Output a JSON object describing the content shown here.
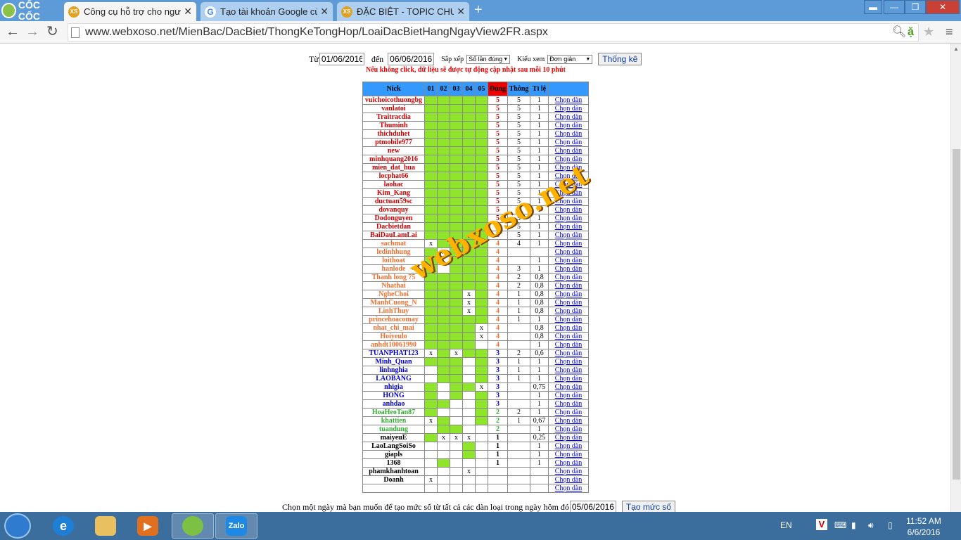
{
  "browser": {
    "brand": "CỐC CỐC",
    "tabs": [
      {
        "label": "Công cụ hỗ trợ cho người",
        "active": true
      },
      {
        "label": "Tạo tài khoản Google của",
        "active": false
      },
      {
        "label": "ĐẶC BIỆT - TOPIC CHUYÊN",
        "active": false
      }
    ],
    "url": "www.webxoso.net/MienBac/DacBiet/ThongKeTongHop/LoaiDacBietHangNgayView2FR.aspx"
  },
  "filter": {
    "from_label": "Từ",
    "from_value": "01/06/2016",
    "to_label": "đến",
    "to_value": "06/06/2016",
    "sort_label": "Sắp xếp",
    "sort_value": "Số lần đúng",
    "view_label": "Kiểu xem",
    "view_value": "Đơn giản",
    "submit_label": "Thống kê"
  },
  "note": "Nếu không click, dữ liệu sẽ được tự động cập nhật sau mỗi 10 phút",
  "table": {
    "headers": [
      "Nick",
      "01",
      "02",
      "03",
      "04",
      "05",
      "Đúng",
      "Thông",
      "Tỉ lệ",
      ""
    ],
    "link_label": "Chọn dàn",
    "rows": [
      {
        "nick": "vuichoicothuongbg",
        "c": [
          "g",
          "g",
          "g",
          "g",
          "g"
        ],
        "dung": "5",
        "thong": "5",
        "tile": "1",
        "color": "#d00000"
      },
      {
        "nick": "vanlatoi",
        "c": [
          "g",
          "g",
          "g",
          "g",
          "g"
        ],
        "dung": "5",
        "thong": "5",
        "tile": "1",
        "color": "#d00000"
      },
      {
        "nick": "Traitracdia",
        "c": [
          "g",
          "g",
          "g",
          "g",
          "g"
        ],
        "dung": "5",
        "thong": "5",
        "tile": "1",
        "color": "#d00000"
      },
      {
        "nick": "Thuminh",
        "c": [
          "g",
          "g",
          "g",
          "g",
          "g"
        ],
        "dung": "5",
        "thong": "5",
        "tile": "1",
        "color": "#d00000"
      },
      {
        "nick": "thichduhet",
        "c": [
          "g",
          "g",
          "g",
          "g",
          "g"
        ],
        "dung": "5",
        "thong": "5",
        "tile": "1",
        "color": "#d00000"
      },
      {
        "nick": "ptmobile977",
        "c": [
          "g",
          "g",
          "g",
          "g",
          "g"
        ],
        "dung": "5",
        "thong": "5",
        "tile": "1",
        "color": "#d00000"
      },
      {
        "nick": "new",
        "c": [
          "g",
          "g",
          "g",
          "g",
          "g"
        ],
        "dung": "5",
        "thong": "5",
        "tile": "1",
        "color": "#d00000"
      },
      {
        "nick": "minhquang2016",
        "c": [
          "g",
          "g",
          "g",
          "g",
          "g"
        ],
        "dung": "5",
        "thong": "5",
        "tile": "1",
        "color": "#d00000"
      },
      {
        "nick": "mien_dat_hua",
        "c": [
          "g",
          "g",
          "g",
          "g",
          "g"
        ],
        "dung": "5",
        "thong": "5",
        "tile": "1",
        "color": "#d00000"
      },
      {
        "nick": "locphat66",
        "c": [
          "g",
          "g",
          "g",
          "g",
          "g"
        ],
        "dung": "5",
        "thong": "5",
        "tile": "1",
        "color": "#d00000"
      },
      {
        "nick": "laohac",
        "c": [
          "g",
          "g",
          "g",
          "g",
          "g"
        ],
        "dung": "5",
        "thong": "5",
        "tile": "1",
        "color": "#d00000"
      },
      {
        "nick": "Kim_Kang",
        "c": [
          "g",
          "g",
          "g",
          "g",
          "g"
        ],
        "dung": "5",
        "thong": "5",
        "tile": "1",
        "color": "#d00000"
      },
      {
        "nick": "ductuan59sc",
        "c": [
          "g",
          "g",
          "g",
          "g",
          "g"
        ],
        "dung": "5",
        "thong": "5",
        "tile": "1",
        "color": "#d00000"
      },
      {
        "nick": "dovanquy",
        "c": [
          "g",
          "g",
          "g",
          "g",
          "g"
        ],
        "dung": "5",
        "thong": "5",
        "tile": "1",
        "color": "#d00000"
      },
      {
        "nick": "Dodonguyen",
        "c": [
          "g",
          "g",
          "g",
          "g",
          "g"
        ],
        "dung": "5",
        "thong": "5",
        "tile": "1",
        "color": "#d00000"
      },
      {
        "nick": "Dacbietdan",
        "c": [
          "g",
          "g",
          "g",
          "g",
          "g"
        ],
        "dung": "5",
        "thong": "5",
        "tile": "1",
        "color": "#d00000"
      },
      {
        "nick": "BaiDauLamLai",
        "c": [
          "g",
          "g",
          "g",
          "g",
          "g"
        ],
        "dung": "5",
        "thong": "5",
        "tile": "1",
        "color": "#d00000"
      },
      {
        "nick": "sachmat",
        "c": [
          "x",
          "g",
          "g",
          "g",
          "g"
        ],
        "dung": "4",
        "thong": "4",
        "tile": "1",
        "color": "#f07030"
      },
      {
        "nick": "ledinhhung",
        "c": [
          "g",
          "x",
          "g",
          "g",
          "g"
        ],
        "dung": "4",
        "thong": "",
        "tile": "",
        "color": "#f07030"
      },
      {
        "nick": "loithoat",
        "c": [
          "g",
          "",
          "g",
          "g",
          "g"
        ],
        "dung": "4",
        "thong": "",
        "tile": "1",
        "color": "#f07030"
      },
      {
        "nick": "hanlode",
        "c": [
          "g",
          "",
          "g",
          "g",
          "g"
        ],
        "dung": "4",
        "thong": "3",
        "tile": "1",
        "color": "#f07030"
      },
      {
        "nick": "Thanh long 75",
        "c": [
          "g",
          "g",
          "g",
          "g",
          "g"
        ],
        "dung": "4",
        "thong": "2",
        "tile": "0,8",
        "color": "#f07030"
      },
      {
        "nick": "Nhathai",
        "c": [
          "g",
          "g",
          "g",
          "g",
          "g"
        ],
        "dung": "4",
        "thong": "2",
        "tile": "0,8",
        "color": "#f07030"
      },
      {
        "nick": "NgheChoi",
        "c": [
          "g",
          "g",
          "g",
          "x",
          "g"
        ],
        "dung": "4",
        "thong": "1",
        "tile": "0,8",
        "color": "#f07030"
      },
      {
        "nick": "ManhCuong_N",
        "c": [
          "g",
          "g",
          "g",
          "x",
          "g"
        ],
        "dung": "4",
        "thong": "1",
        "tile": "0,8",
        "color": "#f07030"
      },
      {
        "nick": "LinhThuy",
        "c": [
          "g",
          "g",
          "g",
          "x",
          "g"
        ],
        "dung": "4",
        "thong": "1",
        "tile": "0,8",
        "color": "#f07030"
      },
      {
        "nick": "princehoacomay",
        "c": [
          "g",
          "g",
          "g",
          "g",
          "g"
        ],
        "dung": "4",
        "thong": "1",
        "tile": "1",
        "color": "#f07030"
      },
      {
        "nick": "nhat_chi_mai",
        "c": [
          "g",
          "g",
          "g",
          "g",
          "x"
        ],
        "dung": "4",
        "thong": "",
        "tile": "0,8",
        "color": "#f07030"
      },
      {
        "nick": "Hoiyeulo",
        "c": [
          "g",
          "g",
          "g",
          "g",
          "x"
        ],
        "dung": "4",
        "thong": "",
        "tile": "0,8",
        "color": "#f07030"
      },
      {
        "nick": "anhdt10061990",
        "c": [
          "g",
          "g",
          "g",
          "g",
          ""
        ],
        "dung": "4",
        "thong": "",
        "tile": "1",
        "color": "#f07030"
      },
      {
        "nick": "TUANPHAT123",
        "c": [
          "x",
          "g",
          "x",
          "g",
          "g"
        ],
        "dung": "3",
        "thong": "2",
        "tile": "0,6",
        "color": "#0000dd"
      },
      {
        "nick": "Minh_Quan",
        "c": [
          "g",
          "g",
          "g",
          "",
          "g"
        ],
        "dung": "3",
        "thong": "1",
        "tile": "1",
        "color": "#0000dd"
      },
      {
        "nick": "linhnghia",
        "c": [
          "",
          "g",
          "g",
          "",
          "g"
        ],
        "dung": "3",
        "thong": "1",
        "tile": "1",
        "color": "#0000dd"
      },
      {
        "nick": "LAOBANG",
        "c": [
          "",
          "g",
          "g",
          "",
          "g"
        ],
        "dung": "3",
        "thong": "1",
        "tile": "1",
        "color": "#0000dd"
      },
      {
        "nick": "nhigia",
        "c": [
          "g",
          "",
          "g",
          "g",
          "x"
        ],
        "dung": "3",
        "thong": "",
        "tile": "0,75",
        "color": "#0000dd"
      },
      {
        "nick": "HONG",
        "c": [
          "g",
          "",
          "g",
          "",
          "g"
        ],
        "dung": "3",
        "thong": "",
        "tile": "1",
        "color": "#0000dd"
      },
      {
        "nick": "anhdao",
        "c": [
          "g",
          "g",
          "",
          "",
          "g"
        ],
        "dung": "3",
        "thong": "",
        "tile": "1",
        "color": "#0000dd"
      },
      {
        "nick": "HoaHeoTan87",
        "c": [
          "g",
          "",
          "",
          "",
          "g"
        ],
        "dung": "2",
        "thong": "2",
        "tile": "1",
        "color": "#30b030"
      },
      {
        "nick": "khattien",
        "c": [
          "x",
          "g",
          "",
          "",
          "g"
        ],
        "dung": "2",
        "thong": "1",
        "tile": "0,67",
        "color": "#30b030"
      },
      {
        "nick": "tuandung",
        "c": [
          "",
          "g",
          "g",
          "",
          ""
        ],
        "dung": "2",
        "thong": "",
        "tile": "1",
        "color": "#30b030"
      },
      {
        "nick": "maiyeuE",
        "c": [
          "g",
          "x",
          "x",
          "x",
          ""
        ],
        "dung": "1",
        "thong": "",
        "tile": "0,25",
        "color": "#000000"
      },
      {
        "nick": "LaoLangSoiSo",
        "c": [
          "",
          "",
          "",
          "g",
          ""
        ],
        "dung": "1",
        "thong": "",
        "tile": "1",
        "color": "#000000"
      },
      {
        "nick": "giapls",
        "c": [
          "",
          "",
          "",
          "g",
          ""
        ],
        "dung": "1",
        "thong": "",
        "tile": "1",
        "color": "#000000"
      },
      {
        "nick": "1368",
        "c": [
          "",
          "g",
          "",
          "",
          ""
        ],
        "dung": "1",
        "thong": "",
        "tile": "1",
        "color": "#000000"
      },
      {
        "nick": "phamkhanhtoan",
        "c": [
          "",
          "",
          "",
          "x",
          ""
        ],
        "dung": "",
        "thong": "",
        "tile": "",
        "color": "#000000"
      },
      {
        "nick": "Doanh",
        "c": [
          "x",
          "",
          "",
          "",
          ""
        ],
        "dung": "",
        "thong": "",
        "tile": "",
        "color": "#000000"
      },
      {
        "nick": "",
        "c": [
          "",
          "",
          "",
          "",
          ""
        ],
        "dung": "",
        "thong": "",
        "tile": "",
        "color": "#000000"
      }
    ]
  },
  "watermark": "webxoso.net",
  "bottom": {
    "label": "Chọn một ngày mà bạn muốn để tạo mức số từ tất cả các dàn loại trong ngày hôm đó",
    "date_value": "05/06/2016",
    "button_label": "Tạo mức số"
  },
  "taskbar": {
    "zalo_label": "Zalo",
    "lang": "EN",
    "time": "11:52 AM",
    "date": "6/6/2016"
  }
}
